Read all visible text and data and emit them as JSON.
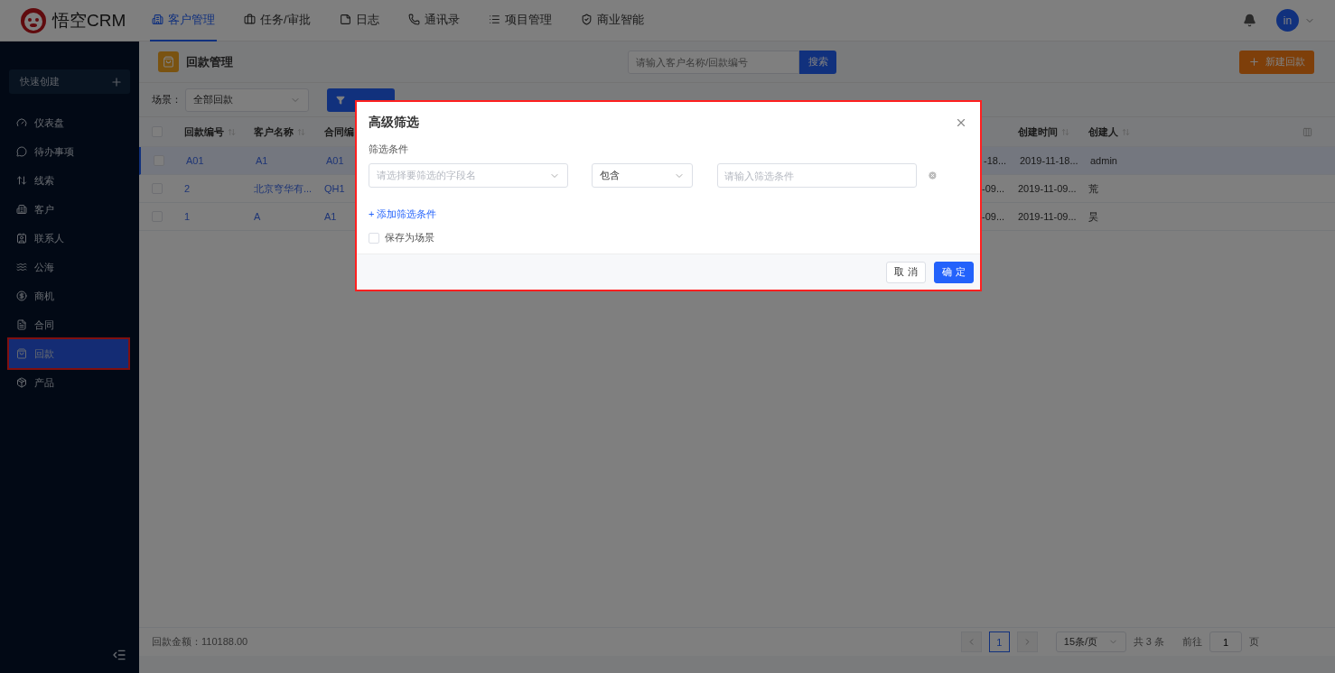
{
  "logo": {
    "text": "悟空CRM"
  },
  "nav": [
    {
      "label": "客户管理",
      "selected": true
    },
    {
      "label": "任务/审批",
      "selected": false
    },
    {
      "label": "日志",
      "selected": false
    },
    {
      "label": "通讯录",
      "selected": false
    },
    {
      "label": "项目管理",
      "selected": false
    },
    {
      "label": "商业智能",
      "selected": false
    }
  ],
  "user": {
    "avatar": "in"
  },
  "sidebar": {
    "quick_create": "快速创建",
    "items": [
      {
        "label": "仪表盘",
        "selected": false
      },
      {
        "label": "待办事项",
        "selected": false
      },
      {
        "label": "线索",
        "selected": false
      },
      {
        "label": "客户",
        "selected": false
      },
      {
        "label": "联系人",
        "selected": false
      },
      {
        "label": "公海",
        "selected": false
      },
      {
        "label": "商机",
        "selected": false
      },
      {
        "label": "合同",
        "selected": false
      },
      {
        "label": "回款",
        "selected": true
      },
      {
        "label": "产品",
        "selected": false
      }
    ]
  },
  "page": {
    "title": "回款管理",
    "search_placeholder": "请输入客户名称/回款编号",
    "search_button": "搜索",
    "new_button": "新建回款"
  },
  "filter": {
    "scene_label": "场景：",
    "scene_value": "全部回款"
  },
  "table": {
    "select_all_checked": false,
    "columns": [
      {
        "label": "回款编号",
        "sortable": true
      },
      {
        "label": "客户名称",
        "sortable": true
      },
      {
        "label": "合同编",
        "sortable": false
      },
      {},
      {
        "label": "创建时间",
        "sortable": true
      },
      {
        "label": "创建人",
        "sortable": true
      }
    ],
    "rows": [
      {
        "selected": true,
        "checked": false,
        "cells": [
          "A01",
          "A1",
          "A01",
          "-18...",
          "2019-11-18...",
          "admin"
        ]
      },
      {
        "selected": false,
        "checked": false,
        "cells": [
          "2",
          "北京穹华有...",
          "QH1",
          "-09...",
          "2019-11-09...",
          "荒"
        ]
      },
      {
        "selected": false,
        "checked": false,
        "cells": [
          "1",
          "A",
          "A1",
          "-09...",
          "2019-11-09...",
          "昊"
        ]
      }
    ]
  },
  "footer": {
    "total": "回款金额：110188.00",
    "pages": [
      {
        "label": "1",
        "selected": true
      }
    ],
    "page_size": "15条/页",
    "count": "共 3 条",
    "goto_label": "前往",
    "goto_value": "1",
    "goto_unit": "页"
  },
  "dialog": {
    "title": "高级筛选",
    "section": "筛选条件",
    "field_placeholder": "请选择要筛选的字段名",
    "operator": "包含",
    "value_placeholder": "请输入筛选条件",
    "add": "+ 添加筛选条件",
    "save_scene": {
      "label": "保存为场景",
      "checked": false
    },
    "cancel": "取 消",
    "confirm": "确 定"
  }
}
